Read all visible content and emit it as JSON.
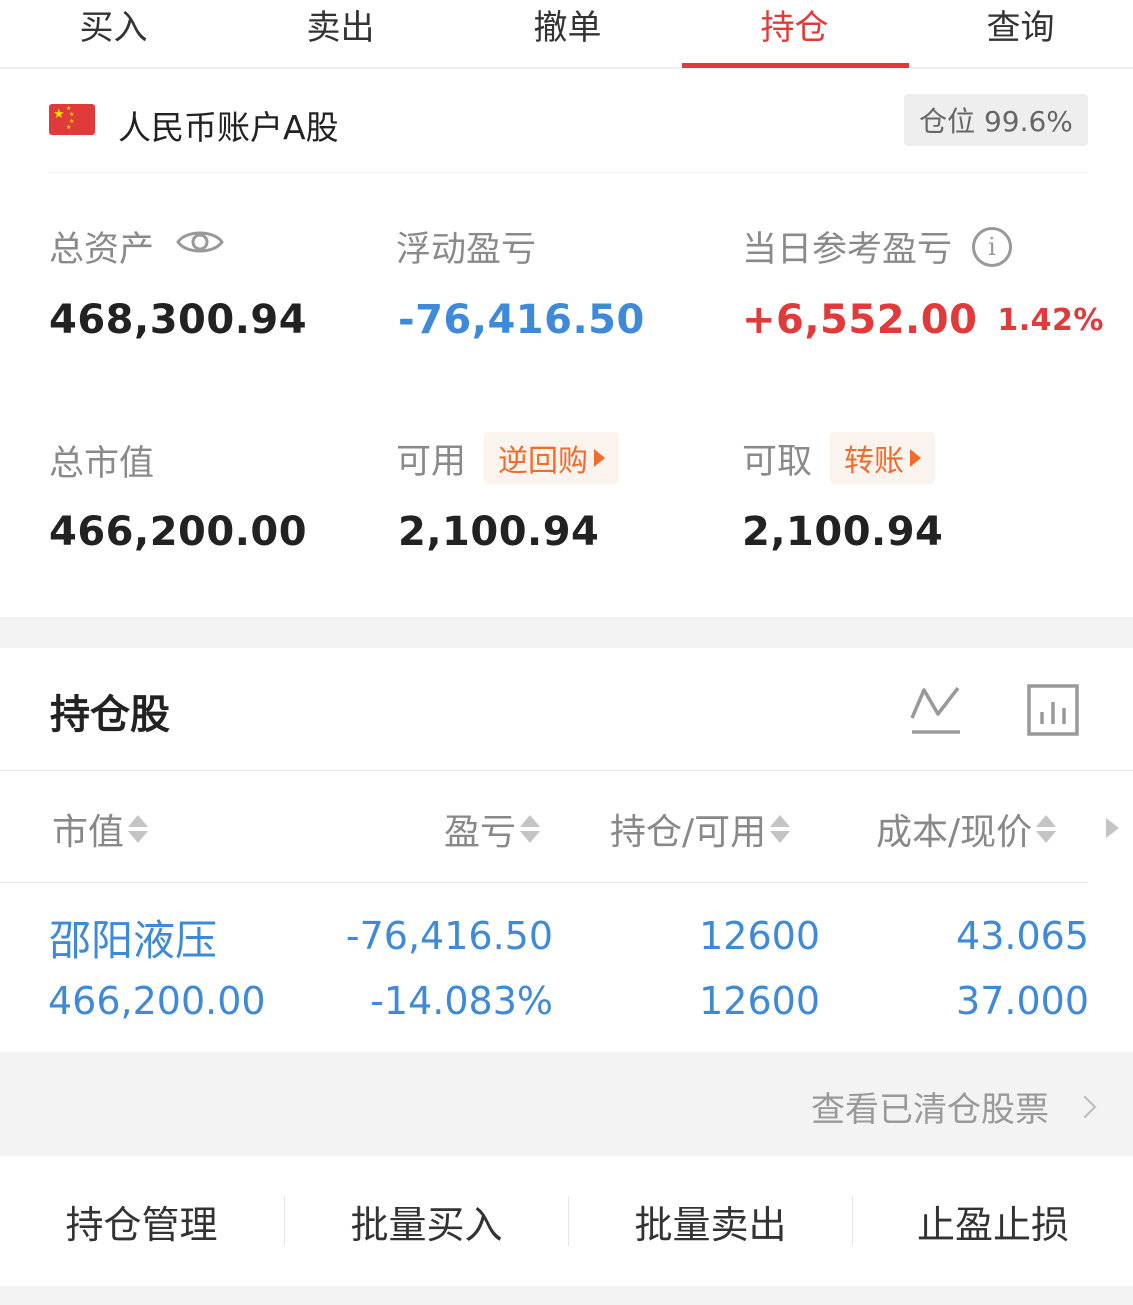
{
  "tabs": [
    {
      "label": "买入",
      "active": false
    },
    {
      "label": "卖出",
      "active": false
    },
    {
      "label": "撤单",
      "active": false
    },
    {
      "label": "持仓",
      "active": true
    },
    {
      "label": "查询",
      "active": false
    }
  ],
  "account": {
    "flag_icon": "china-flag-icon",
    "name": "人民币账户A股",
    "position_ratio": "仓位 99.6%",
    "total_assets": {
      "label": "总资产",
      "value": "468,300.94"
    },
    "floating_pnl": {
      "label": "浮动盈亏",
      "value": "-76,416.50"
    },
    "daily_ref_pnl": {
      "label": "当日参考盈亏",
      "value": "+6,552.00",
      "pct": "1.42%"
    },
    "total_market_value": {
      "label": "总市值",
      "value": "466,200.00"
    },
    "available": {
      "label": "可用",
      "tag": "逆回购",
      "value": "2,100.94"
    },
    "withdrawable": {
      "label": "可取",
      "tag": "转账",
      "value": "2,100.94"
    }
  },
  "holdings": {
    "title": "持仓股",
    "columns": [
      "市值",
      "盈亏",
      "持仓/可用",
      "成本/现价"
    ],
    "rows": [
      {
        "name": "邵阳液压",
        "market_value": "466,200.00",
        "pnl": "-76,416.50",
        "pnl_pct": "-14.083%",
        "position": "12600",
        "available": "12600",
        "cost": "43.065",
        "price": "37.000"
      }
    ]
  },
  "cleared_link": "查看已清仓股票",
  "actions": [
    "持仓管理",
    "批量买入",
    "批量卖出",
    "止盈止损"
  ],
  "colors": {
    "accent": "#e03a3a",
    "link_blue": "#3f8ad8",
    "tag_orange": "#ef6c2c"
  }
}
